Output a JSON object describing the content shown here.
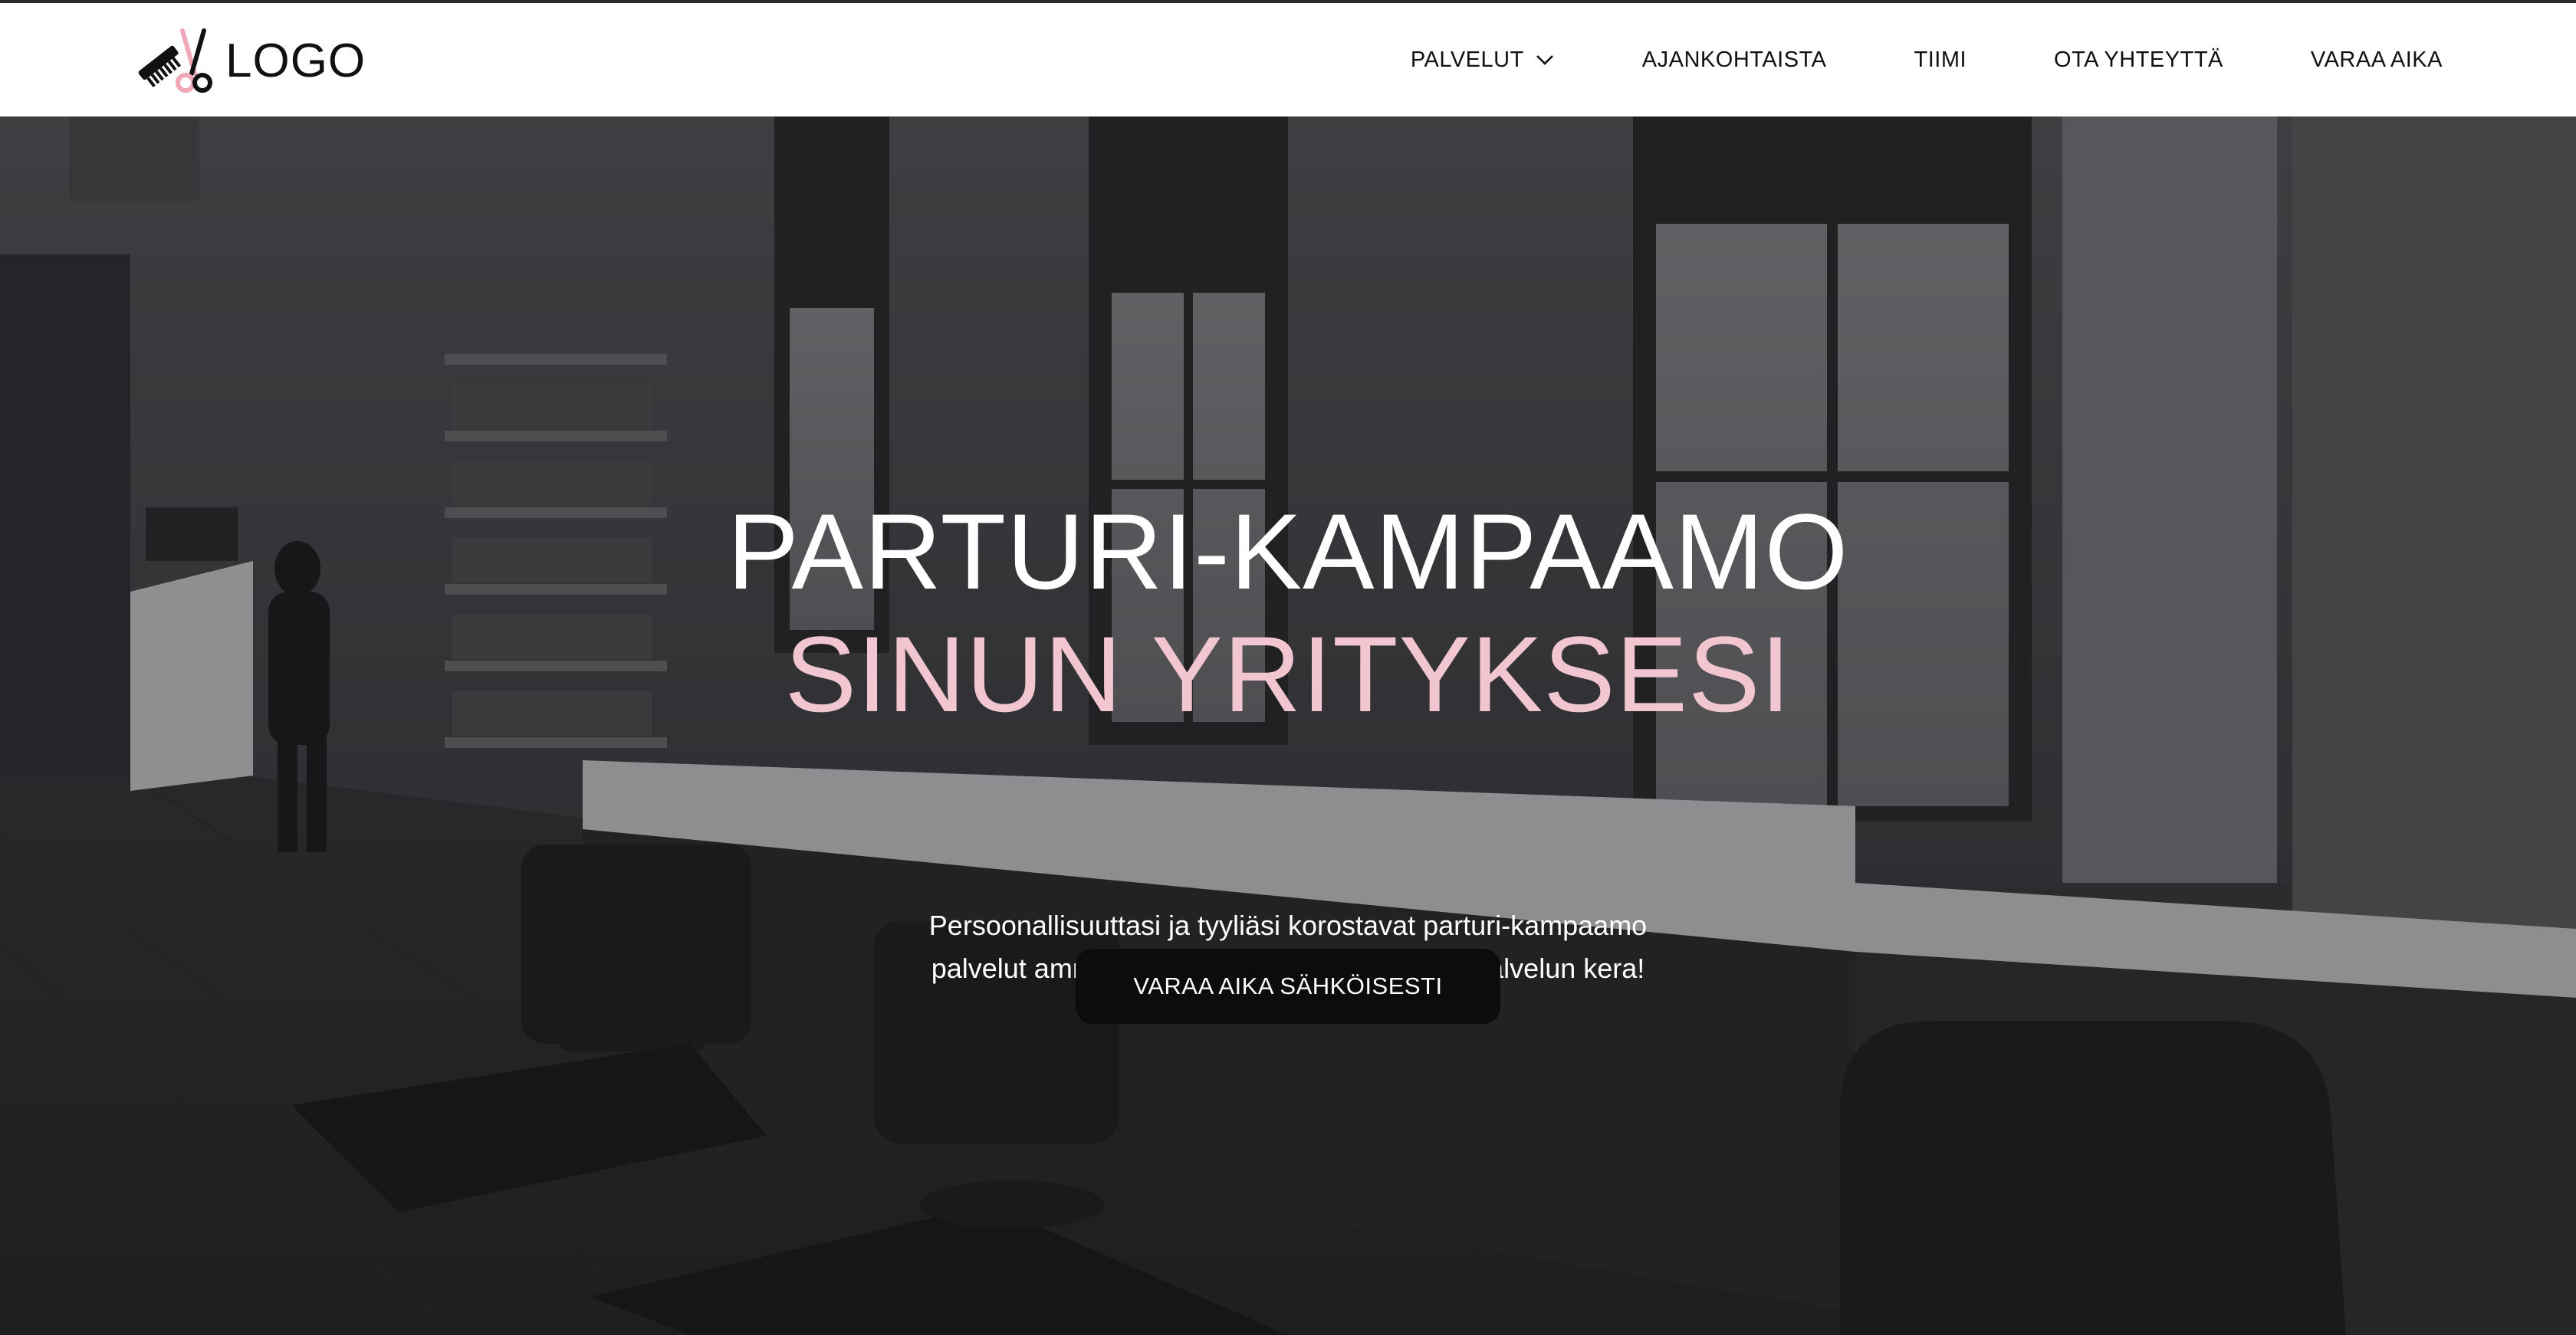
{
  "header": {
    "logo_text": "LOGO",
    "logo_icon": "comb-scissors-icon",
    "nav": [
      {
        "label": "PALVELUT",
        "icon": "chevron-down-icon"
      },
      {
        "label": "AJANKOHTAISTA"
      },
      {
        "label": "TIIMI"
      },
      {
        "label": "OTA YHTEYTTÄ"
      },
      {
        "label": "VARAA AIKA"
      }
    ]
  },
  "hero": {
    "title_line1": "PARTURI-KAMPAAMO",
    "title_line2": "SINUN YRITYKSESI",
    "description_line1": "Persoonallisuuttasi ja tyyliäsi korostavat parturi-kampaamo",
    "description_line2": "palvelut ammattitaidolla toteutettuina iloisen palvelun kera!",
    "cta_label": "VARAA AIKA SÄHKÖISESTI"
  },
  "colors": {
    "accent_pink": "#f2c6d0",
    "header_bg": "#ffffff",
    "button_bg": "#0c0c0d",
    "text_dark": "#111111"
  }
}
